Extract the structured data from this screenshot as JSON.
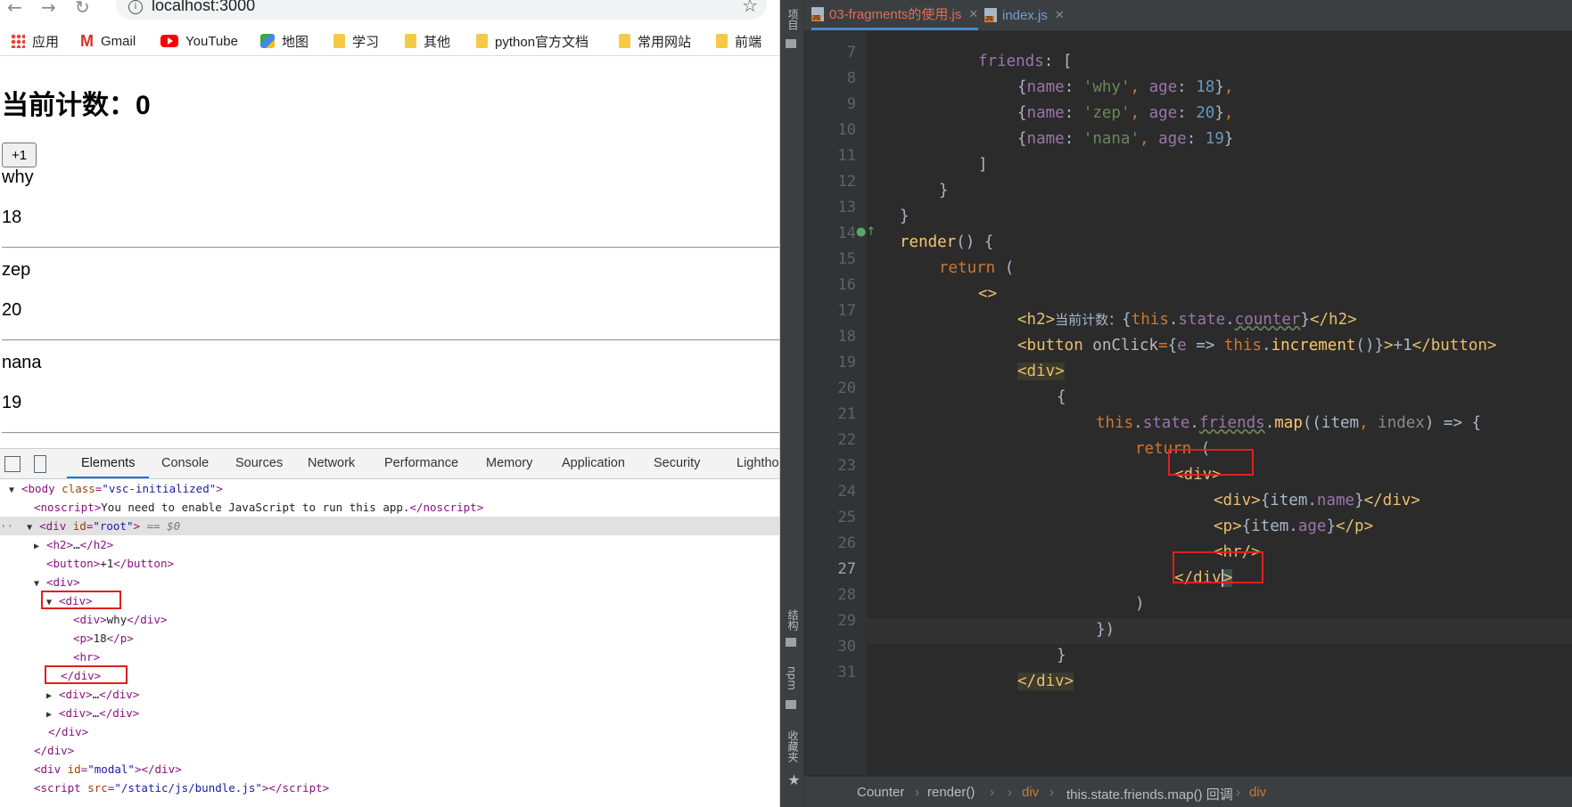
{
  "browser": {
    "url": "localhost:3000",
    "bookmarks": [
      {
        "label": "应用",
        "icon": "apps-icon"
      },
      {
        "label": "Gmail",
        "icon": "gmail-icon"
      },
      {
        "label": "YouTube",
        "icon": "youtube-icon"
      },
      {
        "label": "地图",
        "icon": "maps-icon"
      },
      {
        "label": "学习",
        "icon": "folder-icon"
      },
      {
        "label": "其他",
        "icon": "folder-icon"
      },
      {
        "label": "python官方文档",
        "icon": "folder-icon"
      },
      {
        "label": "常用网站",
        "icon": "folder-icon"
      },
      {
        "label": "前端",
        "icon": "folder-icon"
      }
    ],
    "page": {
      "heading": "当前计数：0",
      "button_label": "+1",
      "friends": [
        {
          "name": "why",
          "age": "18"
        },
        {
          "name": "zep",
          "age": "20"
        },
        {
          "name": "nana",
          "age": "19"
        }
      ]
    }
  },
  "devtools": {
    "tabs": [
      "Elements",
      "Console",
      "Sources",
      "Network",
      "Performance",
      "Memory",
      "Application",
      "Security",
      "Lighthouse"
    ],
    "active_tab": "Elements",
    "tree": {
      "body_open": "<body class=\"vsc-initialized\">",
      "noscript_text": "You need to enable JavaScript to run this app.",
      "root_selected_marker": "== $0",
      "h2_collapsed": "…",
      "button_text": "+1",
      "inner_div_text": "why",
      "p_text": "18",
      "collapsed_ellipsis": "…",
      "modal_id": "modal",
      "script_src": "/static/js/bundle.js"
    }
  },
  "ide": {
    "tabs": [
      {
        "label": "03-fragments的使用.js",
        "active": true,
        "color": "#e06c5a"
      },
      {
        "label": "index.js",
        "active": false,
        "color": "#6e9ed7"
      }
    ],
    "strip_labels": {
      "project": "项目",
      "structure": "结构",
      "npm": "npm",
      "favorites": "收藏夹"
    },
    "current_line": 27,
    "line_numbers": [
      7,
      8,
      9,
      10,
      11,
      12,
      13,
      14,
      15,
      16,
      17,
      18,
      19,
      20,
      21,
      22,
      23,
      24,
      25,
      26,
      27,
      28,
      29,
      30,
      31
    ],
    "code": {
      "l7_prop": "friends",
      "l7_rest": ": [",
      "l8_name": "why",
      "l8_age": "18",
      "l9_name": "zep",
      "l9_age": "20",
      "l10_name": "nana",
      "l10_age": "19",
      "l17_text": "当前计数：",
      "l18_label": "+1"
    },
    "breadcrumbs": [
      "Counter",
      "render()",
      "div",
      "this.state.friends.map() 回调",
      "div"
    ]
  },
  "colors": {
    "ide_bg": "#2b2b2b",
    "keyword": "#cc7832",
    "string": "#6a8759",
    "number": "#6897bb",
    "property": "#9876aa",
    "function": "#ffc66d",
    "highlight_box": "#e02020"
  }
}
